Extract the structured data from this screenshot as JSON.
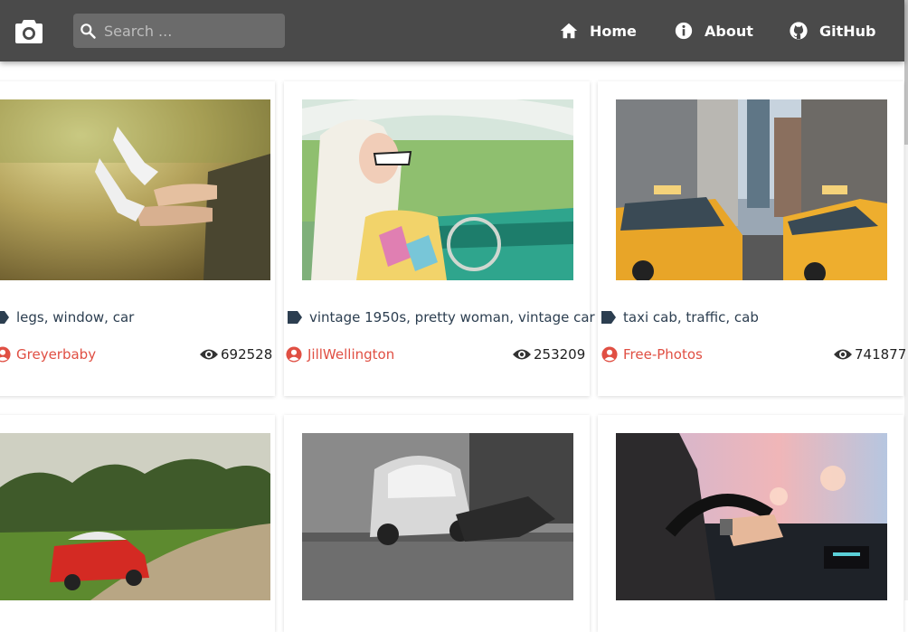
{
  "search": {
    "placeholder": "Search ..."
  },
  "nav": {
    "home": "Home",
    "about": "About",
    "github": "GitHub"
  },
  "cards": [
    {
      "tags": "legs, window, car",
      "author": "Greyerbaby",
      "views": "692528"
    },
    {
      "tags": "vintage 1950s, pretty woman, vintage car",
      "author": "JillWellington",
      "views": "253209"
    },
    {
      "tags": "taxi cab, traffic, cab",
      "author": "Free-Photos",
      "views": "741877"
    }
  ],
  "colors": {
    "topbar": "#4a4a4a",
    "author": "#e04f43",
    "tag": "#2c3e50"
  }
}
